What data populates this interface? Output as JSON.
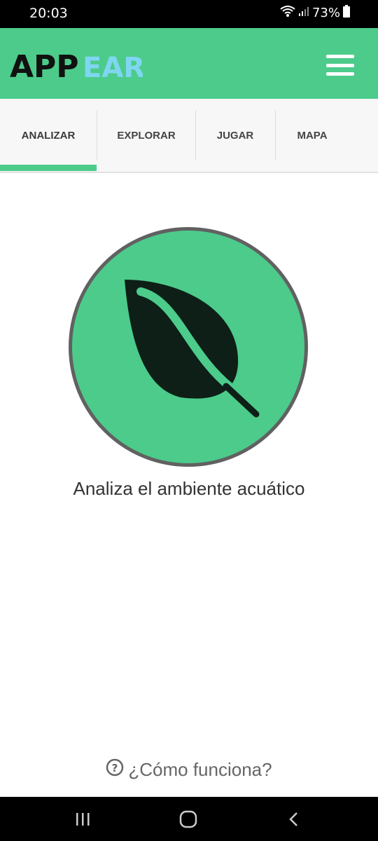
{
  "status_bar": {
    "time": "20:03",
    "battery": "73%"
  },
  "header": {
    "logo_part1": "APP",
    "logo_part2": "EAR",
    "colors": {
      "bg": "#4ccb8b",
      "logo_dark": "#111111",
      "logo_light": "#7fd6f0"
    }
  },
  "tabs": [
    {
      "label": "ANALIZAR",
      "active": true
    },
    {
      "label": "EXPLORAR",
      "active": false
    },
    {
      "label": "JUGAR",
      "active": false
    },
    {
      "label": "MAPA",
      "active": false
    }
  ],
  "main": {
    "icon": "leaf-icon",
    "caption": "Analiza el ambiente acuático",
    "help_link": "¿Cómo funciona?"
  },
  "nav": {
    "recents": "recents-icon",
    "home": "home-icon",
    "back": "back-icon"
  },
  "theme": {
    "accent": "#4ccb8b",
    "circle_border": "#616161",
    "leaf": "#0d1f17"
  }
}
